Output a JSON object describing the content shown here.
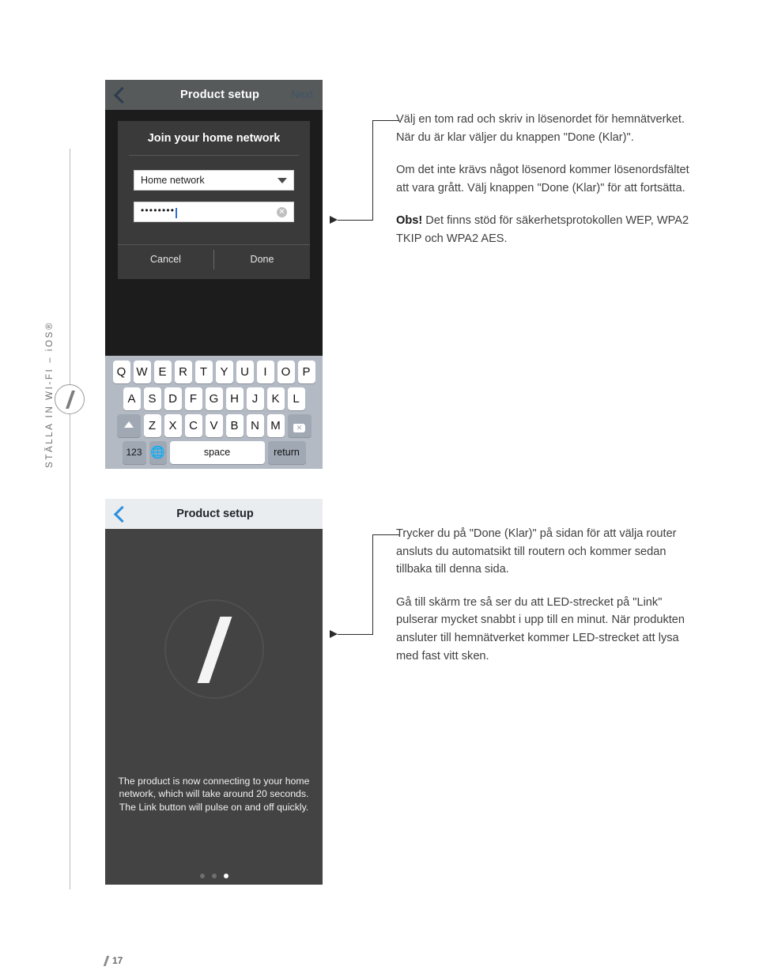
{
  "page": {
    "side_label": "STÄLLA IN WI-FI – iOS®",
    "footer_page": "17"
  },
  "screen1": {
    "nav": {
      "back_icon": "chevron-left-icon",
      "title": "Product setup",
      "next_label": "Next"
    },
    "dialog": {
      "title": "Join your home network",
      "network_value": "Home network",
      "network_dropdown_icon": "chevron-down-icon",
      "password_value": "••••••••",
      "password_clear_icon": "clear-circle-icon",
      "cancel_label": "Cancel",
      "done_label": "Done"
    },
    "keyboard": {
      "row1": [
        "Q",
        "W",
        "E",
        "R",
        "T",
        "Y",
        "U",
        "I",
        "O",
        "P"
      ],
      "row2": [
        "A",
        "S",
        "D",
        "F",
        "G",
        "H",
        "J",
        "K",
        "L"
      ],
      "row3": [
        "Z",
        "X",
        "C",
        "V",
        "B",
        "N",
        "M"
      ],
      "shift_icon": "shift-arrow-icon",
      "delete_icon": "backspace-icon",
      "numbers_label": "123",
      "globe_icon": "globe-icon",
      "space_label": "space",
      "return_label": "return"
    }
  },
  "screen2": {
    "nav": {
      "back_icon": "chevron-left-icon",
      "title": "Product setup"
    },
    "logo_icon": "slash-logo-icon",
    "caption": "The product is now connecting to your home network, which will take around 20 seconds. The Link button will pulse on and off quickly.",
    "page_dots": [
      "inactive",
      "inactive",
      "active"
    ]
  },
  "callouts": {
    "block1": {
      "p1": "Välj en tom rad och skriv in lösenordet för hemnätverket. När du är klar väljer du knappen \"Done (Klar)\".",
      "p2": "Om det inte krävs något lösenord kommer lösenordsfältet att vara grått. Välj knappen \"Done (Klar)\" för att fortsätta.",
      "p3_bold": "Obs!",
      "p3_rest": " Det finns stöd för säkerhetsprotokollen WEP, WPA2 TKIP och WPA2 AES."
    },
    "block2": {
      "p1": "Trycker du på \"Done (Klar)\" på sidan för att välja router ansluts du automatsikt till routern och kommer sedan tillbaka till denna sida.",
      "p2": "Gå till skärm tre så ser du att LED-strecket på \"Link\" pulserar mycket snabbt i upp till en minut. När produkten ansluter till hemnätverket kommer LED-strecket att lysa med fast vitt sken."
    }
  },
  "colors": {
    "navbar_dark": "#575a5a",
    "navbar_light": "#eaedef",
    "screen_bg_dark": "#1c1c1c",
    "dialog_bg": "#3a3a3a",
    "keyboard_bg": "#b3bac4",
    "accent_blue": "#2b8fe0",
    "text_gray": "#3f3f3f"
  }
}
